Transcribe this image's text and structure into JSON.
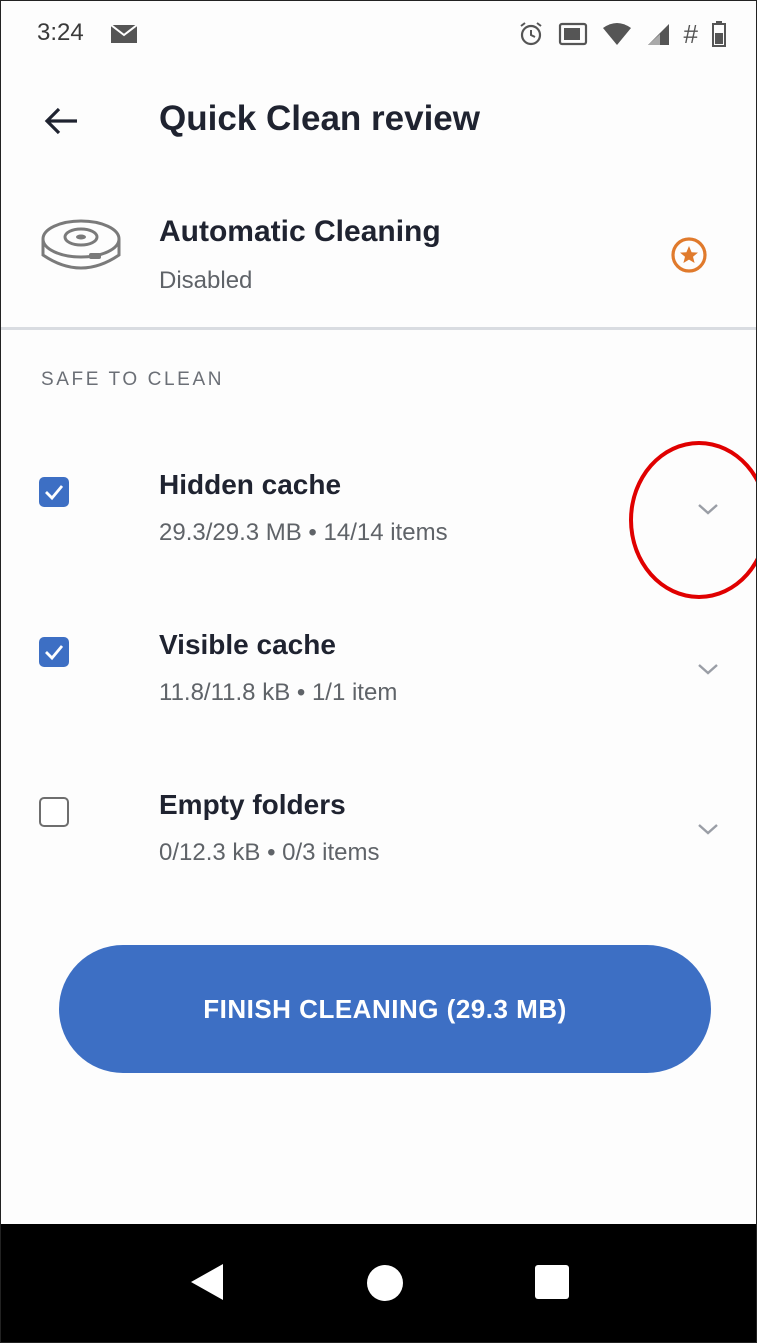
{
  "status_bar": {
    "time": "3:24",
    "icons": [
      "mail-icon",
      "alarm-icon",
      "cast-icon",
      "wifi-icon",
      "signal-icon",
      "hash-icon",
      "battery-icon"
    ],
    "hash_text": "#"
  },
  "header": {
    "title": "Quick Clean review",
    "back_icon": "arrow-left-icon"
  },
  "automatic_cleaning": {
    "title": "Automatic Cleaning",
    "status": "Disabled",
    "icon": "robot-vacuum-icon",
    "badge_icon": "star-badge-icon",
    "badge_color": "#e07a2c"
  },
  "section": {
    "header": "SAFE TO CLEAN"
  },
  "items": [
    {
      "title": "Hidden cache",
      "detail": "29.3/29.3 MB • 14/14 items",
      "checked": true
    },
    {
      "title": "Visible cache",
      "detail": "11.8/11.8 kB • 1/1 item",
      "checked": true
    },
    {
      "title": "Empty folders",
      "detail": "0/12.3 kB • 0/3 items",
      "checked": false
    }
  ],
  "finish_button": {
    "label": "FINISH CLEANING (29.3 MB)"
  },
  "colors": {
    "accent": "#3d6fc4",
    "badge": "#e07a2c",
    "annotation": "#e00000"
  }
}
